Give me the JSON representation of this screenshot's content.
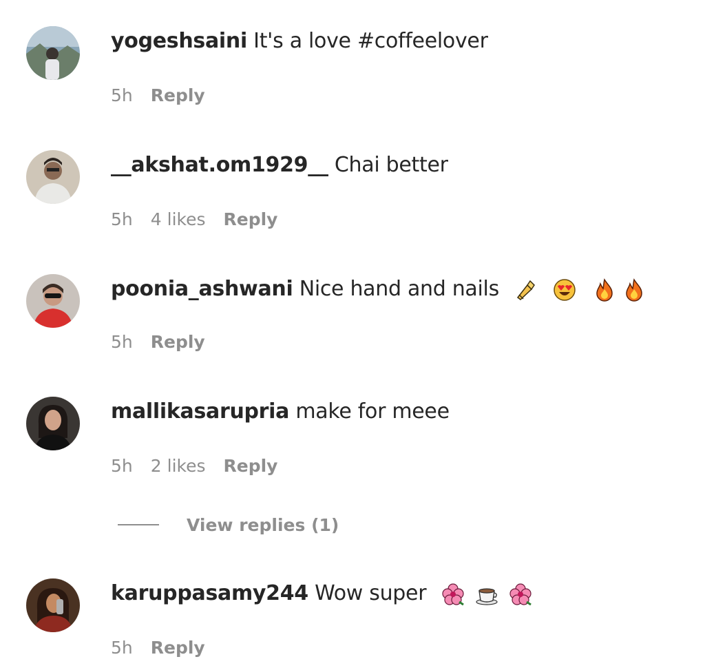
{
  "comments": [
    {
      "username": "yogeshsaini",
      "text": " It's a love #coffeelover",
      "time": "5h",
      "likes": "",
      "reply_label": "Reply",
      "emojis": []
    },
    {
      "username": "__akshat.om1929__",
      "text": " Chai better",
      "time": "5h",
      "likes": "4 likes",
      "reply_label": "Reply",
      "emojis": []
    },
    {
      "username": "poonia_ashwani",
      "text": " Nice hand and nails",
      "time": "5h",
      "likes": "",
      "reply_label": "Reply",
      "emojis": [
        "nail-polish-icon",
        "heart-eyes-icon",
        "fire-icon",
        "fire-icon"
      ]
    },
    {
      "username": "mallikasarupria",
      "text": " make for meee",
      "time": "5h",
      "likes": "2 likes",
      "reply_label": "Reply",
      "emojis": []
    },
    {
      "username": "karuppasamy244",
      "text": " Wow super",
      "time": "5h",
      "likes": "",
      "reply_label": "Reply",
      "emojis": [
        "hibiscus-icon",
        "hot-beverage-icon",
        "hibiscus-icon"
      ]
    }
  ],
  "view_replies": {
    "label": "View replies (1)"
  },
  "colors": {
    "text": "#262626",
    "secondary": "#8e8e8e",
    "background": "#ffffff"
  }
}
